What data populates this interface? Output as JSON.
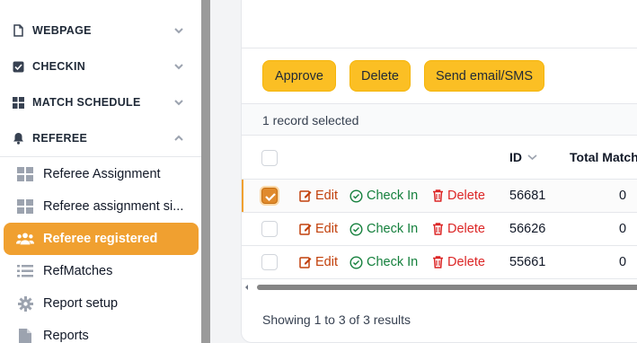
{
  "sidebar": {
    "sections": [
      {
        "label": "WEBPAGE",
        "icon": "document-icon",
        "chevron": "chevron-down"
      },
      {
        "label": "CHECKIN",
        "icon": "checkbox-icon",
        "chevron": "chevron-down"
      },
      {
        "label": "MATCH SCHEDULE",
        "icon": "grid-icon",
        "chevron": "chevron-down"
      },
      {
        "label": "REFEREE",
        "icon": "bell-icon",
        "chevron": "chevron-up"
      }
    ],
    "items": [
      {
        "label": "Referee Assignment",
        "icon": "grid-icon"
      },
      {
        "label": "Referee assignment si...",
        "icon": "grid-icon"
      },
      {
        "label": "Referee registered",
        "icon": "users-icon",
        "active": true
      },
      {
        "label": "RefMatches",
        "icon": "list-icon"
      },
      {
        "label": "Report setup",
        "icon": "gear-icon"
      },
      {
        "label": "Reports",
        "icon": "file-icon"
      }
    ]
  },
  "toolbar": {
    "approve_label": "Approve",
    "delete_label": "Delete",
    "send_label": "Send email/SMS"
  },
  "selection": {
    "text": "1 record selected"
  },
  "table": {
    "columns": {
      "id": "ID",
      "total": "Total Match"
    },
    "actions": {
      "edit": "Edit",
      "check_in": "Check In",
      "delete": "Delete"
    },
    "rows": [
      {
        "id": "56681",
        "total": "0",
        "selected": true
      },
      {
        "id": "56626",
        "total": "0",
        "selected": false
      },
      {
        "id": "55661",
        "total": "0",
        "selected": false
      }
    ]
  },
  "footer": {
    "text": "Showing 1 to 3 of 3 results"
  },
  "colors": {
    "accent": "#f0a030",
    "button": "#fbbf24",
    "edit": "#c2410c",
    "check": "#15803d",
    "delete": "#dc2626"
  }
}
